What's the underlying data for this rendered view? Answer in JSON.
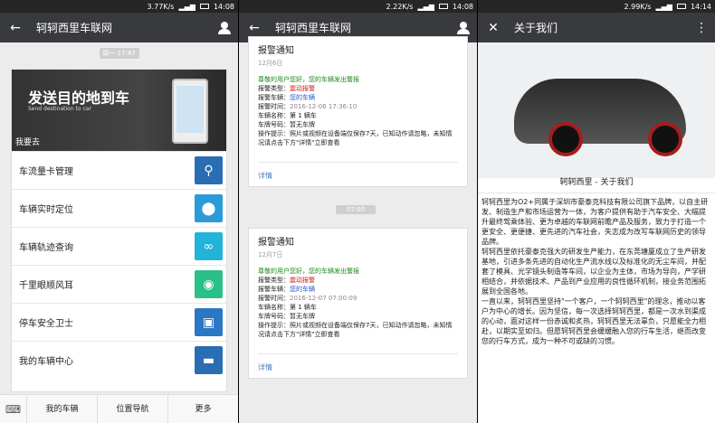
{
  "panel1": {
    "status": {
      "speed": "3.77K/s",
      "time": "14:08"
    },
    "title": "轲轲西里车联网",
    "time_chip": "周一 17:47",
    "banner": {
      "headline": "发送目的地到车",
      "english": "Send destination to car",
      "sub": "我要去"
    },
    "menu": [
      {
        "label": "车流量卡管理",
        "icon": "signal-tower-icon",
        "color": "#2a6db3"
      },
      {
        "label": "车辆实时定位",
        "icon": "location-pin-icon",
        "color": "#2a9bd8"
      },
      {
        "label": "车辆轨迹查询",
        "icon": "route-loop-icon",
        "color": "#22b3d9"
      },
      {
        "label": "千里眼顺风耳",
        "icon": "camera-icon",
        "color": "#2bbf8a"
      },
      {
        "label": "停车安全卫士",
        "icon": "parking-guard-icon",
        "color": "#2a78c3"
      },
      {
        "label": "我的车辆中心",
        "icon": "car-icon",
        "color": "#2a6db3"
      }
    ],
    "tabs": [
      "我的车辆",
      "位置导航",
      "更多"
    ]
  },
  "panel2": {
    "status": {
      "speed": "2.22K/s",
      "time": "14:08"
    },
    "title": "轲轲西里车联网",
    "time_chip": "07:00",
    "alarms": [
      {
        "title": "报警通知",
        "date": "12月6日",
        "greeting": "尊敬的用户您好，您的车辆发出警报",
        "type_label": "报警类型：",
        "type_value": "震动报警",
        "vehicle_label": "报警车辆：",
        "vehicle_value": "您的车辆",
        "time_label": "报警时间：",
        "time_value": "2016-12-06 17:36:10",
        "name_label": "车辆名称：",
        "name_value": "第 1 辆车",
        "plate_label": "车牌号码：",
        "plate_value": "暂无车牌",
        "tip_label": "操作提示：",
        "tip_value": "照片或视频在设备端仅保存7天，已知动作请忽略，未知情况请点击下方\"详情\"立即查看",
        "detail": "详情"
      },
      {
        "title": "报警通知",
        "date": "12月7日",
        "greeting": "尊敬的用户您好，您的车辆发出警报",
        "type_label": "报警类型：",
        "type_value": "震动报警",
        "vehicle_label": "报警车辆：",
        "vehicle_value": "您的车辆",
        "time_label": "报警时间：",
        "time_value": "2016-12-07 07:00:09",
        "name_label": "车辆名称：",
        "name_value": "第 1 辆车",
        "plate_label": "车牌号码：",
        "plate_value": "暂无车牌",
        "tip_label": "操作提示：",
        "tip_value": "照片或视频在设备端仅保存7天，已知动作请忽略，未知情况请点击下方\"详情\"立即查看",
        "detail": "详情"
      }
    ]
  },
  "panel3": {
    "status": {
      "speed": "2.99K/s",
      "time": "14:14"
    },
    "title": "关于我们",
    "card_title": "轲轲西里 - 关于我们",
    "paragraphs": [
      "轲轲西里为O2+同属于深圳市豪泰克科技有限公司旗下品牌，以自主研发、制造生产和市场运营为一体，为客户提供有助于汽车安全、大幅提升最终驾乘体验、更为卓越的车联网前瞻产品及服务，致力于打造一个更安全、更便捷、更先进的汽车社会，失志成为改写车联网历史的领导品牌。",
      "轲轲西里依托豪泰克强大的研发生产能力，在东莞塘厦成立了生产研发基地，引进多条先进的自动化生产流水线以及标准化的无尘车间，并配套了模具、光学镜头制造等车间，以企业为主体，市场为导向，产学研相结合，并依据技术、产品到产业应用的良性循环机制，接业务范围拓展到全国各地。",
      "一直以来，轲轲西里坚持\"一个客户，一个轲轲西里\"的理念，推动以客户为中心的增长。因为坚信，每一次选择轲轲西里，都是一次水到渠成的心动，面对这样一份赤诚和炙热，轲轲西里无法辜负，只愿能全力相赴，以期实至如归。但愿轲轲西里会缓缓融入您的行车生活，继而改变您的行车方式，成为一种不可或缺的习惯。"
    ]
  }
}
